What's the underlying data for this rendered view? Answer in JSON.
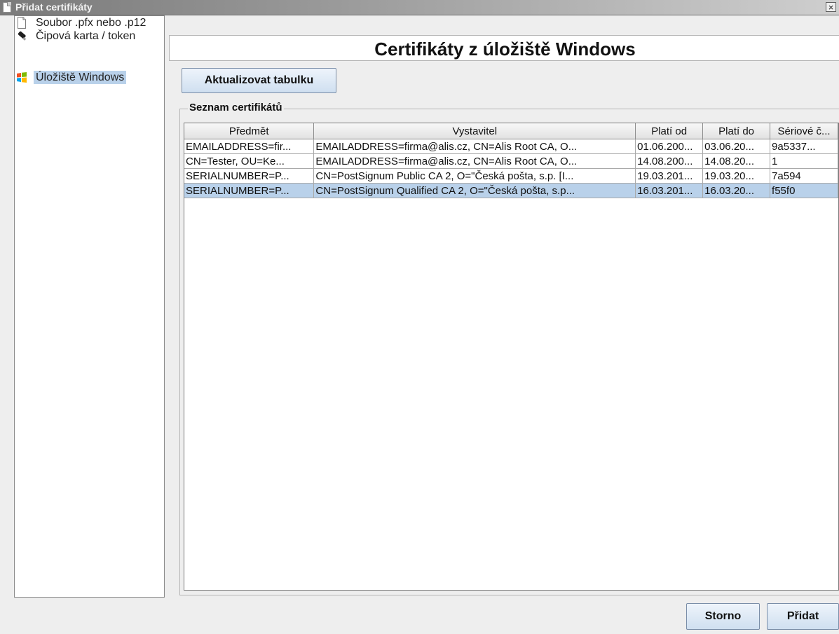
{
  "window": {
    "title": "Přidat certifikáty",
    "close_symbol": "×"
  },
  "sidebar": {
    "items": [
      {
        "label": "Soubor .pfx nebo .p12",
        "icon": "file-icon",
        "selected": false
      },
      {
        "label": "Čipová karta / token",
        "icon": "usb-token-icon",
        "selected": false
      },
      {
        "label": "Úložiště Windows",
        "icon": "windows-logo-icon",
        "selected": true
      }
    ]
  },
  "main": {
    "title": "Certifikáty z úložiště Windows",
    "refresh_label": "Aktualizovat tabulku",
    "group_label": "Seznam certifikátů",
    "table": {
      "columns": [
        "Předmět",
        "Vystavitel",
        "Platí od",
        "Platí do",
        "Sériové č..."
      ],
      "rows": [
        [
          "EMAILADDRESS=fir...",
          "EMAILADDRESS=firma@alis.cz, CN=Alis Root CA, O...",
          "01.06.200...",
          "03.06.20...",
          "9a5337..."
        ],
        [
          "CN=Tester, OU=Ke...",
          "EMAILADDRESS=firma@alis.cz, CN=Alis Root CA, O...",
          "14.08.200...",
          "14.08.20...",
          "1"
        ],
        [
          "SERIALNUMBER=P...",
          "CN=PostSignum Public CA 2, O=\"Česká pošta, s.p. [I...",
          "19.03.201...",
          "19.03.20...",
          "7a594"
        ],
        [
          "SERIALNUMBER=P...",
          "CN=PostSignum Qualified CA 2, O=\"Česká pošta, s.p...",
          "16.03.201...",
          "16.03.20...",
          "f55f0"
        ]
      ],
      "selected_row": 3
    }
  },
  "footer": {
    "cancel_label": "Storno",
    "add_label": "Přidat"
  },
  "colors": {
    "selection": "#b9d1ea",
    "background": "#eeeeee",
    "button_top": "#eef4fb",
    "button_bottom": "#cfdff0"
  }
}
